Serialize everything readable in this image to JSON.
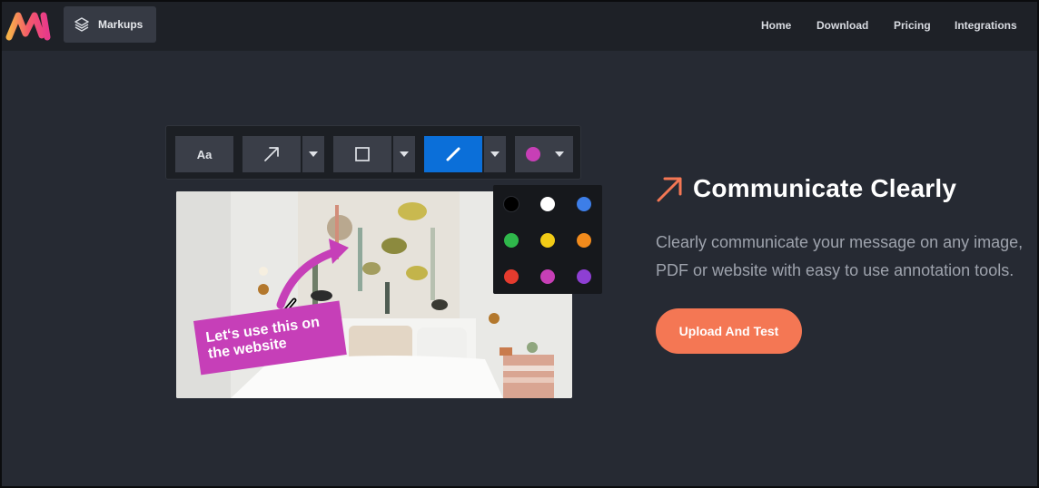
{
  "header": {
    "logo_icon": "markup-m-logo",
    "markups_label": "Markups",
    "nav": [
      "Home",
      "Download",
      "Pricing",
      "Integrations"
    ]
  },
  "toolbar": {
    "text_tool_label": "Aa",
    "tools": [
      "text",
      "arrow",
      "rectangle",
      "pen",
      "color"
    ],
    "selected_tool": "pen",
    "selected_color": "#c73fb6",
    "selected_tool_color": "#0b6fd9"
  },
  "palette": {
    "colors": [
      "#000000",
      "#ffffff",
      "#3d7ee8",
      "#2fb84b",
      "#f2cb16",
      "#f28b1c",
      "#e53b2e",
      "#c73fb6",
      "#8e3fd3"
    ]
  },
  "annotation": {
    "callout_line1": "Let‘s use this on",
    "callout_line2": "the website",
    "callout_color": "#c63fb8"
  },
  "hero": {
    "title": "Communicate Clearly",
    "description_line1": "Clearly communicate your message on any image,",
    "description_line2": "PDF or website with easy to use annotation tools.",
    "cta_label": "Upload And Test",
    "accent_color": "#f47754"
  }
}
